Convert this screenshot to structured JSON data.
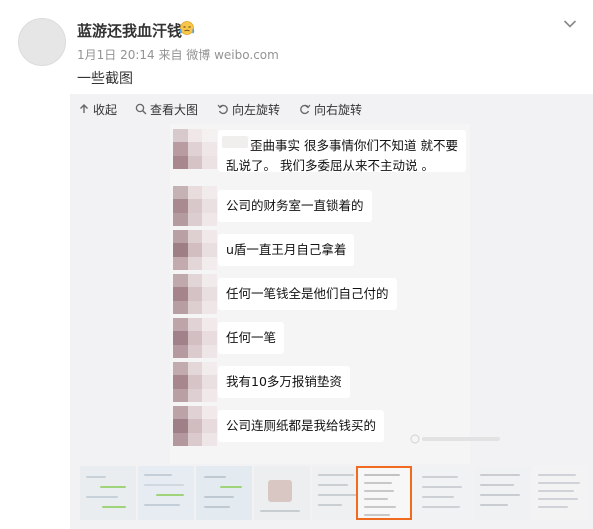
{
  "post": {
    "username": "蓝游还我血汗钱",
    "meta": "1月1日 20:14 来自 微博 weibo.com",
    "text": "一些截图"
  },
  "toolbar": {
    "collapse": "收起",
    "view_large": "查看大图",
    "rotate_left": "向左旋转",
    "rotate_right": "向右旋转"
  },
  "screenshot": {
    "messages": [
      "歪曲事实 很多事情你们不知道 就不要",
      "乱说了。 我们多委屈从来不主动说 。",
      "公司的财务室一直锁着的",
      "u盾一直王月自己拿着",
      "任何一笔钱全是他们自己付的",
      "任何一笔",
      "我有10多万报销垫资",
      "公司连厕纸都是我给钱买的"
    ]
  },
  "thumbnails": {
    "count": 9,
    "selected_index": 5
  },
  "colors": {
    "accent": "#f06a20",
    "media_bg": "#f2f2f5",
    "meta_text": "#939393"
  }
}
